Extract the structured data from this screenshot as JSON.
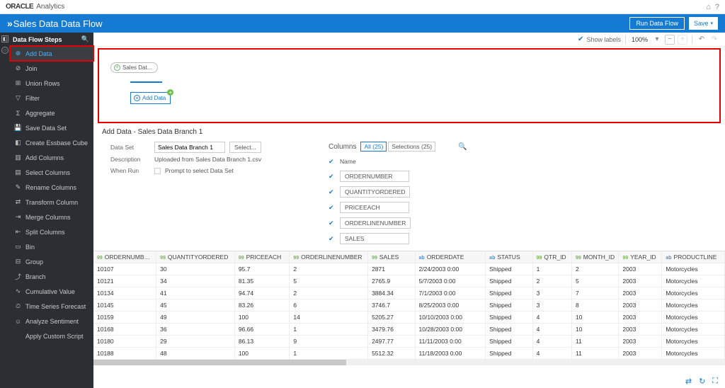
{
  "brand": {
    "logo": "ORACLE",
    "sub": "Analytics"
  },
  "title_bar": {
    "title": "Sales Data Data Flow",
    "run": "Run Data Flow",
    "save": "Save"
  },
  "canvas_toolbar": {
    "show_labels": "Show labels",
    "zoom": "100%"
  },
  "sidebar": {
    "header": "Data Flow Steps",
    "items": [
      {
        "label": "Add Data",
        "icon": "⊕",
        "active": true,
        "highlight": true
      },
      {
        "label": "Join",
        "icon": "⊘"
      },
      {
        "label": "Union Rows",
        "icon": "⊞"
      },
      {
        "label": "Filter",
        "icon": "▽"
      },
      {
        "label": "Aggregate",
        "icon": "Σ"
      },
      {
        "label": "Save Data Set",
        "icon": "💾"
      },
      {
        "label": "Create Essbase Cube",
        "icon": "◧"
      },
      {
        "label": "Add Columns",
        "icon": "▥"
      },
      {
        "label": "Select Columns",
        "icon": "▤"
      },
      {
        "label": "Rename Columns",
        "icon": "✎"
      },
      {
        "label": "Transform Column",
        "icon": "⇄"
      },
      {
        "label": "Merge Columns",
        "icon": "⇥"
      },
      {
        "label": "Split Columns",
        "icon": "⇤"
      },
      {
        "label": "Bin",
        "icon": "▭"
      },
      {
        "label": "Group",
        "icon": "⊟"
      },
      {
        "label": "Branch",
        "icon": "⤴"
      },
      {
        "label": "Cumulative Value",
        "icon": "∿"
      },
      {
        "label": "Time Series Forecast",
        "icon": "⏲"
      },
      {
        "label": "Analyze Sentiment",
        "icon": "☺"
      },
      {
        "label": "Apply Custom Script",
        "icon": "</>"
      }
    ]
  },
  "canvas": {
    "source_label": "Sales Dat...",
    "add_label": "Add Data"
  },
  "config": {
    "heading": "Add Data - Sales Data Branch 1",
    "dataset_label": "Data Set",
    "dataset_value": "Sales Data Branch 1",
    "select_btn": "Select...",
    "desc_label": "Description",
    "desc_value": "Uploaded from Sales Data Branch 1.csv",
    "when_label": "When Run",
    "when_value": "Prompt to select Data Set"
  },
  "columns_panel": {
    "label": "Columns",
    "tab_all": "All (25)",
    "tab_sel": "Selections (25)",
    "items": [
      "Name",
      "ORDERNUMBER",
      "QUANTITYORDERED",
      "PRICEEACH",
      "ORDERLINENUMBER",
      "SALES"
    ]
  },
  "grid": {
    "headers": [
      {
        "type": "99",
        "label": "ORDERNUMBER"
      },
      {
        "type": "99",
        "label": "QUANTITYORDERED"
      },
      {
        "type": "99",
        "label": "PRICEEACH"
      },
      {
        "type": "99",
        "label": "ORDERLINENUMBER"
      },
      {
        "type": "99",
        "label": "SALES"
      },
      {
        "type": "ab",
        "label": "ORDERDATE"
      },
      {
        "type": "ab",
        "label": "STATUS"
      },
      {
        "type": "99",
        "label": "QTR_ID"
      },
      {
        "type": "99",
        "label": "MONTH_ID"
      },
      {
        "type": "99",
        "label": "YEAR_ID"
      },
      {
        "type": "ab",
        "label": "PRODUCTLINE"
      }
    ],
    "rows": [
      [
        "10107",
        "30",
        "95.7",
        "2",
        "2871",
        "2/24/2003 0:00",
        "Shipped",
        "1",
        "2",
        "2003",
        "Motorcycles"
      ],
      [
        "10121",
        "34",
        "81.35",
        "5",
        "2765.9",
        "5/7/2003 0:00",
        "Shipped",
        "2",
        "5",
        "2003",
        "Motorcycles"
      ],
      [
        "10134",
        "41",
        "94.74",
        "2",
        "3884.34",
        "7/1/2003 0:00",
        "Shipped",
        "3",
        "7",
        "2003",
        "Motorcycles"
      ],
      [
        "10145",
        "45",
        "83.26",
        "6",
        "3746.7",
        "8/25/2003 0:00",
        "Shipped",
        "3",
        "8",
        "2003",
        "Motorcycles"
      ],
      [
        "10159",
        "49",
        "100",
        "14",
        "5205.27",
        "10/10/2003 0:00",
        "Shipped",
        "4",
        "10",
        "2003",
        "Motorcycles"
      ],
      [
        "10168",
        "36",
        "96.66",
        "1",
        "3479.76",
        "10/28/2003 0:00",
        "Shipped",
        "4",
        "10",
        "2003",
        "Motorcycles"
      ],
      [
        "10180",
        "29",
        "86.13",
        "9",
        "2497.77",
        "11/11/2003 0:00",
        "Shipped",
        "4",
        "11",
        "2003",
        "Motorcycles"
      ],
      [
        "10188",
        "48",
        "100",
        "1",
        "5512.32",
        "11/18/2003 0:00",
        "Shipped",
        "4",
        "11",
        "2003",
        "Motorcycles"
      ]
    ]
  }
}
